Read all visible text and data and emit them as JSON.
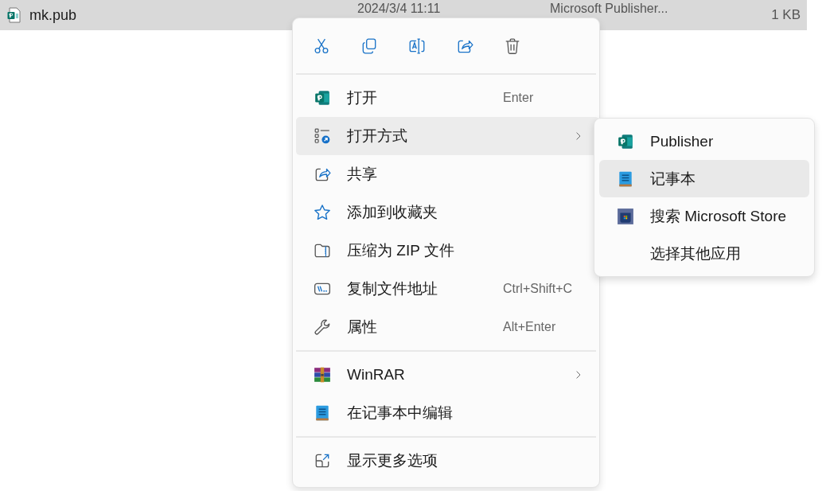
{
  "file_row": {
    "name": "mk.pub",
    "date": "2024/3/4 11:11",
    "type": "Microsoft Publisher...",
    "size": "1 KB",
    "selected": true
  },
  "context_menu": {
    "sections": [
      {
        "items": [
          {
            "label": "打开",
            "shortcut": "Enter",
            "submenu": false,
            "selected": false
          },
          {
            "label": "打开方式",
            "submenu": true,
            "selected": true
          },
          {
            "label": "共享",
            "submenu": false,
            "selected": false
          },
          {
            "label": "添加到收藏夹",
            "submenu": false,
            "selected": false
          },
          {
            "label": "压缩为 ZIP 文件",
            "submenu": false,
            "selected": false
          },
          {
            "label": "复制文件地址",
            "shortcut": "Ctrl+Shift+C",
            "submenu": false,
            "selected": false
          },
          {
            "label": "属性",
            "shortcut": "Alt+Enter",
            "submenu": false,
            "selected": false
          }
        ]
      },
      {
        "items": [
          {
            "label": "WinRAR",
            "submenu": true,
            "selected": false
          },
          {
            "label": "在记事本中编辑",
            "submenu": false,
            "selected": false
          }
        ]
      },
      {
        "items": [
          {
            "label": "显示更多选项",
            "submenu": false,
            "selected": false
          }
        ]
      }
    ]
  },
  "submenu": {
    "items": [
      {
        "label": "Publisher",
        "selected": false
      },
      {
        "label": "记事本",
        "selected": true
      },
      {
        "label": "搜索 Microsoft Store",
        "selected": false
      },
      {
        "label": "选择其他应用",
        "selected": false
      }
    ]
  }
}
